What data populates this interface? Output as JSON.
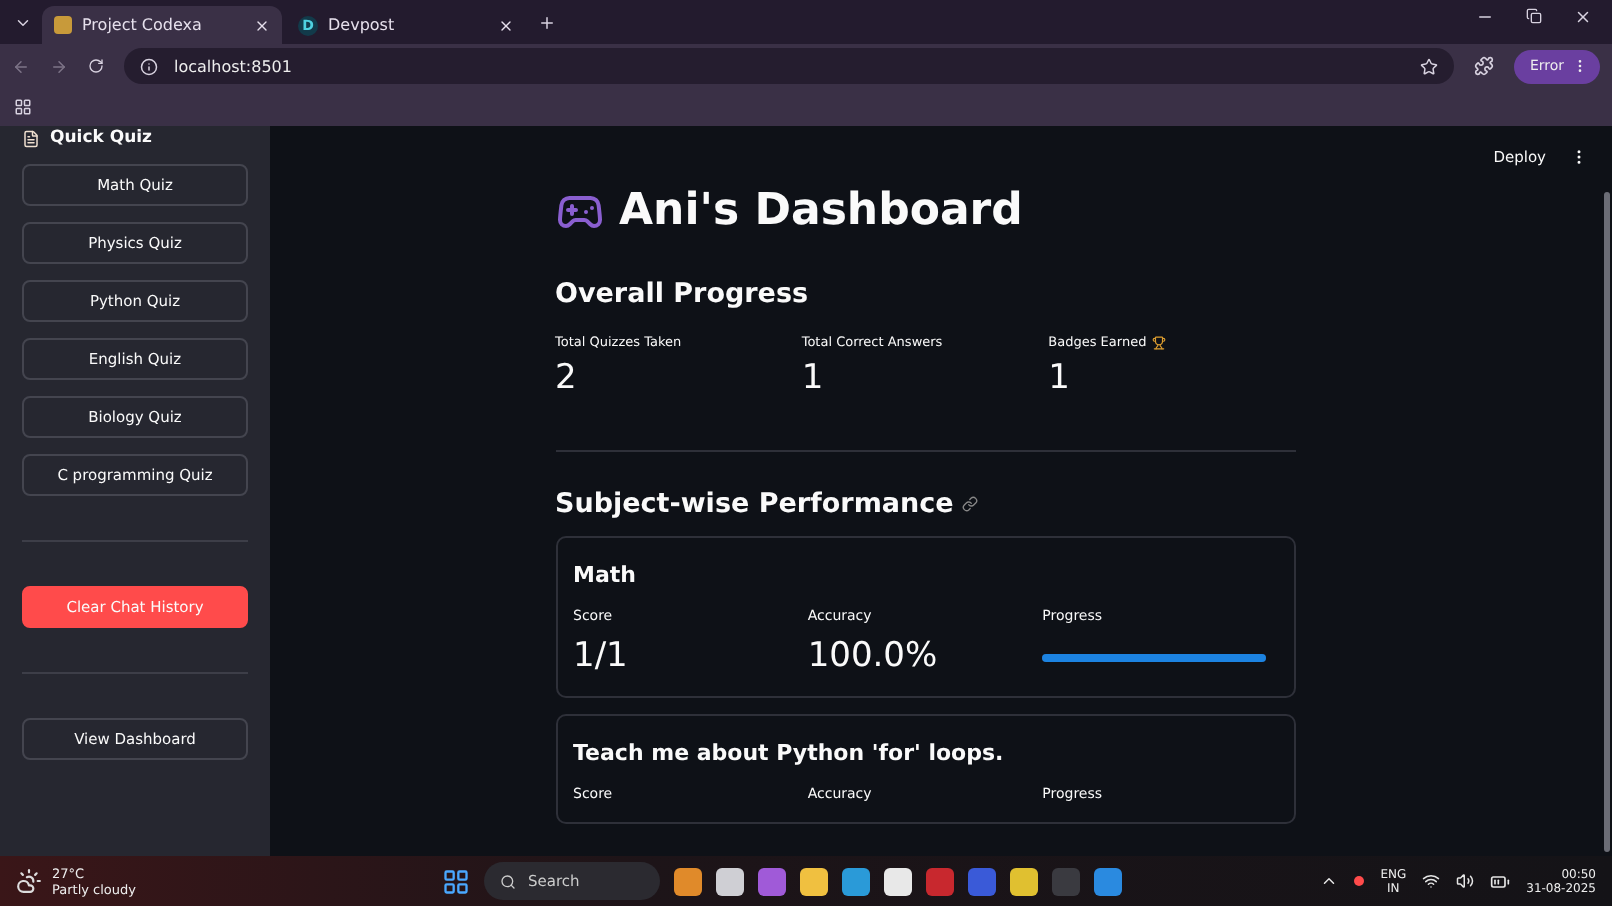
{
  "browser": {
    "tabs": [
      {
        "title": "Project Codexa",
        "selected": true
      },
      {
        "title": "Devpost",
        "selected": false
      }
    ],
    "favicon_letter": "D",
    "address": "localhost:8501",
    "profile_button": "Error"
  },
  "sidebar": {
    "title": "Quick Quiz",
    "quiz_buttons": [
      "Math Quiz",
      "Physics Quiz",
      "Python Quiz",
      "English Quiz",
      "Biology Quiz",
      "C programming Quiz"
    ],
    "clear_button": "Clear Chat History",
    "dashboard_button": "View Dashboard"
  },
  "header": {
    "deploy": "Deploy"
  },
  "main": {
    "title": "Ani's Dashboard",
    "overall_heading": "Overall Progress",
    "metrics": [
      {
        "label": "Total Quizzes Taken",
        "value": "2",
        "trophy": false
      },
      {
        "label": "Total Correct Answers",
        "value": "1",
        "trophy": false
      },
      {
        "label": "Badges Earned",
        "value": "1",
        "trophy": true
      }
    ],
    "subject_heading": "Subject-wise Performance",
    "subjects": [
      {
        "name": "Math",
        "score_label": "Score",
        "score": "1/1",
        "accuracy_label": "Accuracy",
        "accuracy": "100.0%",
        "progress_label": "Progress",
        "level": 1
      },
      {
        "name": "Teach me about Python 'for' loops.",
        "score_label": "Score",
        "accuracy_label": "Accuracy",
        "progress_label": "Progress"
      }
    ]
  },
  "taskbar": {
    "temperature": "27°C",
    "weather": "Partly cloudy",
    "search": "Search",
    "language": "ENG",
    "region": "IN",
    "time": "00:50",
    "date": "31-08-2025"
  }
}
